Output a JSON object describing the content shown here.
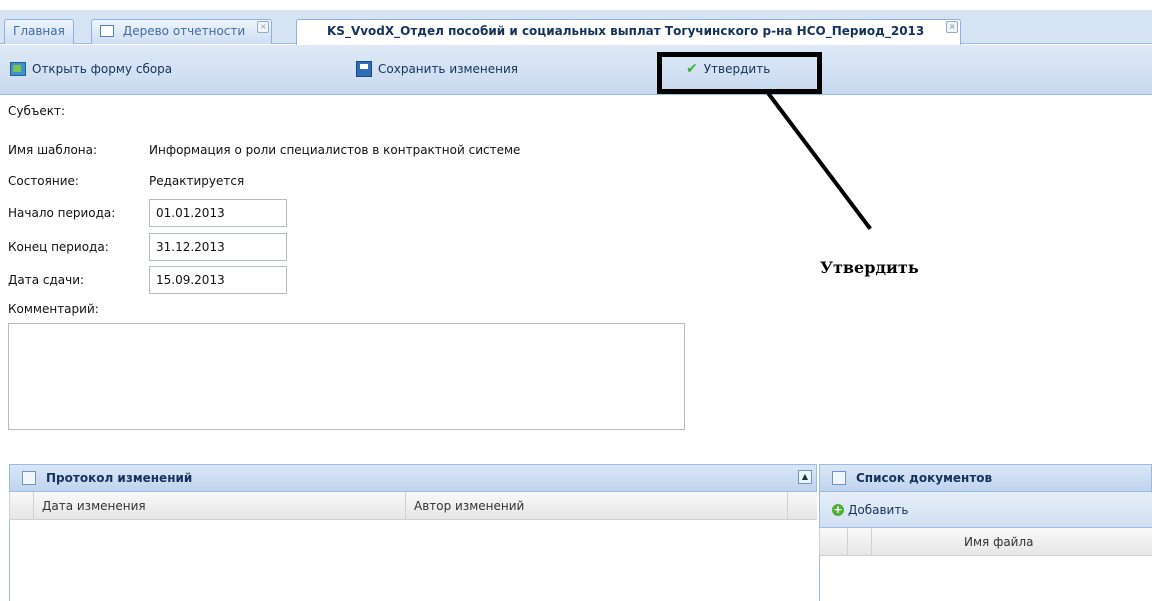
{
  "tabs": [
    {
      "label": "Главная"
    },
    {
      "label": "Дерево отчетности"
    },
    {
      "label": "KS_VvodX_Отдел пособий и социальных выплат Тогучинского р-на НСО_Период_2013"
    }
  ],
  "toolbar": {
    "open_label": "Открыть форму сбора",
    "save_label": "Сохранить изменения",
    "approve_label": "Утвердить"
  },
  "form": {
    "subject_label": "Субъект:",
    "subject_value": "",
    "template_label": "Имя шаблона:",
    "template_value": "Информация о роли специалистов в контрактной системе",
    "state_label": "Состояние:",
    "state_value": "Редактируется",
    "period_start_label": "Начало периода:",
    "period_start_value": "01.01.2013",
    "period_end_label": "Конец периода:",
    "period_end_value": "31.12.2013",
    "due_label": "Дата сдачи:",
    "due_value": "15.09.2013",
    "comment_label": "Комментарий:",
    "comment_value": ""
  },
  "annotation": {
    "text": "Утвердить"
  },
  "history_panel": {
    "title": "Протокол изменений",
    "columns": [
      "Дата изменения",
      "Автор изменений"
    ]
  },
  "documents_panel": {
    "title": "Список документов",
    "add_label": "Добавить",
    "columns": [
      "Имя файла"
    ]
  },
  "colors": {
    "accent": "#15325c",
    "header_bg": "#d5e3f3",
    "border": "#99bbe8"
  }
}
